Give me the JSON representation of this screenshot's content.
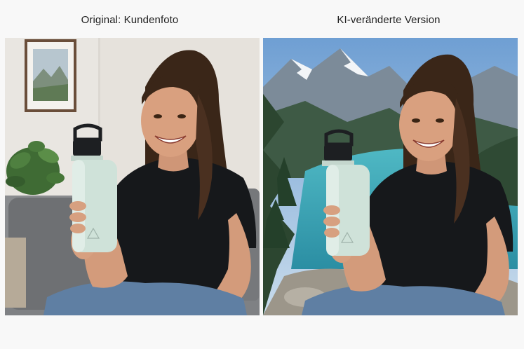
{
  "captions": {
    "original": "Original: Kundenfoto",
    "edited": "KI-veränderte Version"
  },
  "scenes": {
    "original": {
      "background": "living-room wall with framed landscape picture, potted plant, grey sofa",
      "subject": "smiling woman in black t-shirt holding a mint-green insulated water bottle"
    },
    "edited": {
      "background": "mountain lake with turquoise water, pine forest and snowy peaks",
      "subject": "same smiling woman in black t-shirt holding a mint-green insulated water bottle"
    }
  },
  "colors": {
    "page_bg": "#f8f8f8",
    "wall": "#e7e4df",
    "tshirt": "#16181b",
    "bottle": "#cfe2d9",
    "bottle_cap": "#1d1f22",
    "lake": "#3aa8b8",
    "sky": "#8fb6dd",
    "forest": "#2f4a34",
    "hair": "#3a2618",
    "skin": "#d9a07f"
  }
}
